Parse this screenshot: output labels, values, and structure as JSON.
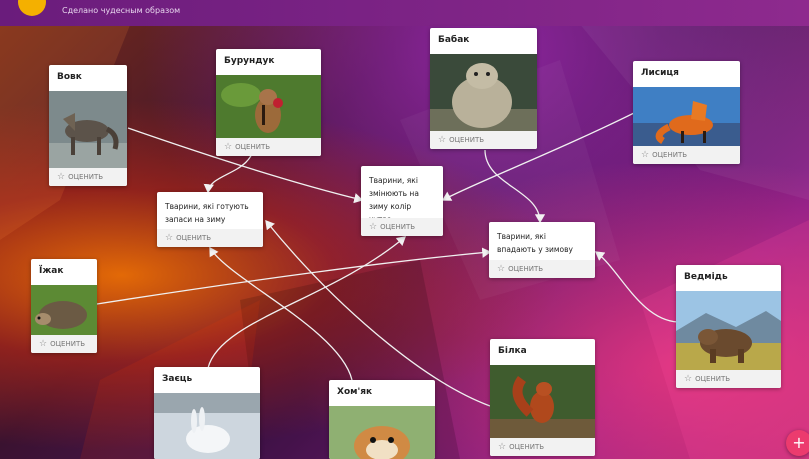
{
  "header": {
    "subtitle": "Сделано чудесным образом"
  },
  "rate_label": "ОЦЕНИТЬ",
  "fab_label": "+",
  "cards": {
    "vovk": {
      "title": "Вовк",
      "image": "wolf-photo"
    },
    "burunduk": {
      "title": "Бурундук",
      "image": "chipmunk-photo"
    },
    "babak": {
      "title": "Бабак",
      "image": "marmot-photo"
    },
    "lysytsia": {
      "title": "Лисиця",
      "image": "fox-photo"
    },
    "yizhak": {
      "title": "Їжак",
      "image": "hedgehog-photo"
    },
    "vedmid": {
      "title": "Ведмідь",
      "image": "bear-photo"
    },
    "bilka": {
      "title": "Білка",
      "image": "squirrel-photo"
    },
    "zaiets": {
      "title": "Заєць",
      "image": "hare-photo"
    },
    "khomiak": {
      "title": "Хом'як",
      "image": "hamster-photo"
    }
  },
  "categories": {
    "zapasy": {
      "text": "Тварини, які готують запаси на зиму"
    },
    "khutro": {
      "text": "Тварини, які змінюють на зиму колір хутра"
    },
    "splachka": {
      "text": "Тварини, які впадають у зимову сплячку"
    }
  },
  "colors": {
    "fab": "#ec3b6e",
    "logo": "#f4b000",
    "topbar": "#7a2286"
  }
}
